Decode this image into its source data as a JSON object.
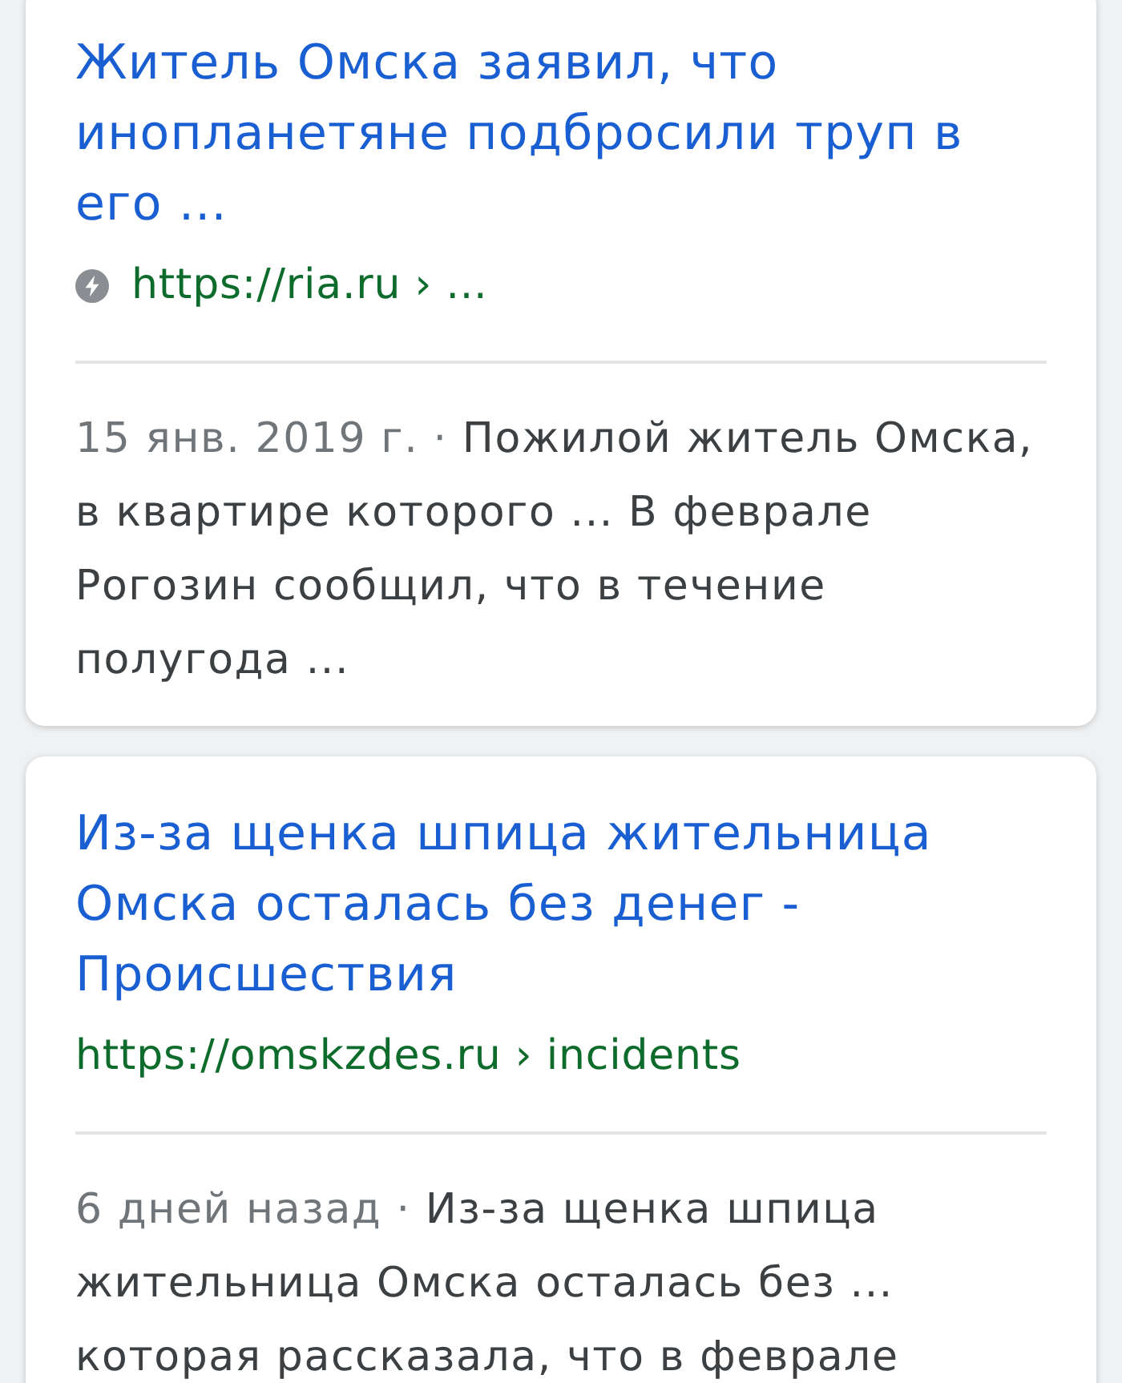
{
  "results": [
    {
      "title": "Житель Омска заявил, что инопланетяне подбросили труп в его ...",
      "amp": true,
      "url": "https://ria.ru › ...",
      "date": "15 янв. 2019 г.",
      "separator": "·",
      "snippet": "Пожилой житель Омска, в квартире которого ... В феврале Рогозин сообщил, что в течение полугода ..."
    },
    {
      "title": "Из-за щенка шпица жительница Омска осталась без денег - Происшествия",
      "amp": false,
      "url": "https://omskzdes.ru › incidents",
      "date": "6 дней назад",
      "separator": "·",
      "snippet": "Из-за щенка шпица жительница Омска осталась без ... которая рассказала, что в феврале"
    }
  ]
}
